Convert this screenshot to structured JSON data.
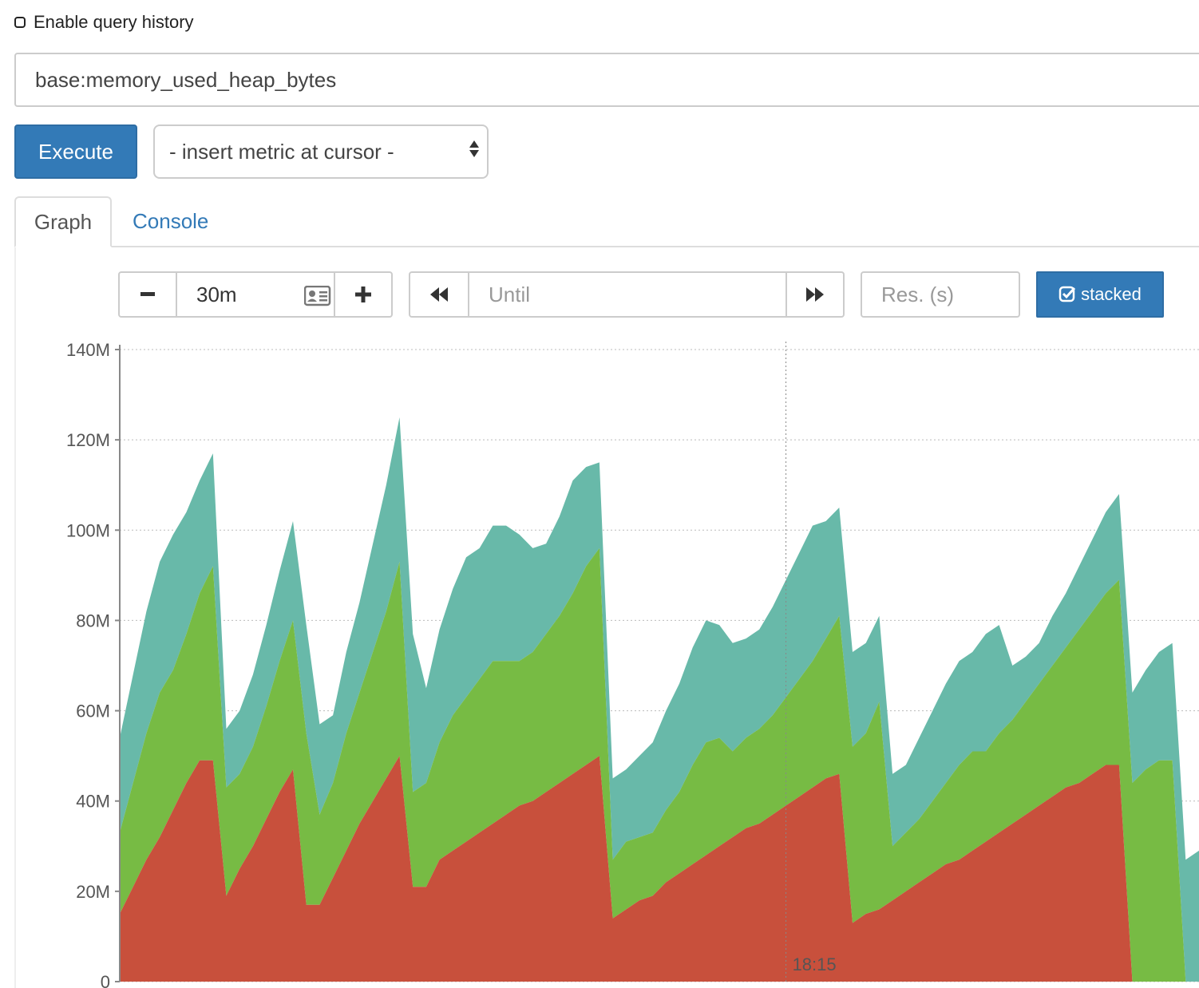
{
  "history": {
    "label": "Enable query history"
  },
  "expression": {
    "value": "base:memory_used_heap_bytes"
  },
  "execute": {
    "label": "Execute"
  },
  "metric_select": {
    "selected": "- insert metric at cursor -"
  },
  "tabs": [
    {
      "label": "Graph"
    },
    {
      "label": "Console"
    }
  ],
  "controls": {
    "minus": "−",
    "range": "30m",
    "plus": "+",
    "until_placeholder": "Until",
    "res_placeholder": "Res. (s)",
    "stacked_label": "stacked"
  },
  "colors": {
    "accent": "#337ab7",
    "series_bottom": "#c8503c",
    "series_middle": "#77bb44",
    "series_top": "#68b9a9"
  },
  "chart_data": {
    "type": "area",
    "stacked": true,
    "ylim": [
      0,
      140000000
    ],
    "y_ticks": [
      {
        "value": 0,
        "label": "0"
      },
      {
        "value": 20000000,
        "label": "20M"
      },
      {
        "value": 40000000,
        "label": "40M"
      },
      {
        "value": 60000000,
        "label": "60M"
      },
      {
        "value": 80000000,
        "label": "80M"
      },
      {
        "value": 100000000,
        "label": "100M"
      },
      {
        "value": 120000000,
        "label": "120M"
      },
      {
        "value": 140000000,
        "label": "140M"
      }
    ],
    "x_ticks": [
      {
        "index": 50,
        "label": "18:15"
      }
    ],
    "grid": true,
    "x": [
      0,
      1,
      2,
      3,
      4,
      5,
      6,
      7,
      8,
      9,
      10,
      11,
      12,
      13,
      14,
      15,
      16,
      17,
      18,
      19,
      20,
      21,
      22,
      23,
      24,
      25,
      26,
      27,
      28,
      29,
      30,
      31,
      32,
      33,
      34,
      35,
      36,
      37,
      38,
      39,
      40,
      41,
      42,
      43,
      44,
      45,
      46,
      47,
      48,
      49,
      50,
      51,
      52,
      53,
      54,
      55,
      56,
      57,
      58,
      59,
      60,
      61,
      62
    ],
    "series": [
      {
        "color": "#c8503c",
        "values": [
          15,
          21,
          27,
          32,
          38,
          44,
          49,
          49,
          19,
          25,
          30,
          36,
          42,
          47,
          17,
          17,
          23,
          29,
          35,
          40,
          45,
          50,
          21,
          21,
          27,
          29,
          31,
          33,
          35,
          37,
          39,
          40,
          42,
          44,
          46,
          48,
          50,
          14,
          16,
          18,
          19,
          22,
          24,
          26,
          28,
          30,
          32,
          34,
          35,
          37,
          39,
          41,
          43,
          45,
          46,
          13,
          15,
          16,
          18,
          20,
          22,
          24,
          26,
          27,
          29,
          31,
          33,
          35,
          37,
          39,
          41,
          43,
          44,
          46,
          48,
          48
        ]
      },
      {
        "color": "#77bb44",
        "values": [
          18,
          23,
          28,
          32,
          31,
          33,
          37,
          43,
          24,
          21,
          22,
          25,
          29,
          33,
          38,
          20,
          21,
          26,
          29,
          33,
          37,
          43,
          21,
          23,
          26,
          30,
          32,
          34,
          36,
          34,
          32,
          33,
          35,
          37,
          40,
          44,
          46,
          13,
          15,
          14,
          14,
          16,
          18,
          22,
          25,
          24,
          19,
          20,
          21,
          22,
          24,
          26,
          28,
          31,
          35,
          39,
          40,
          46,
          12,
          13,
          14,
          16,
          18,
          21,
          22,
          20,
          22,
          23,
          25,
          27,
          29,
          31,
          34,
          36,
          38,
          41,
          44,
          47,
          49,
          49
        ]
      },
      {
        "color": "#68b9a9",
        "values": [
          21,
          24,
          27,
          29,
          30,
          27,
          25,
          25,
          13,
          14,
          16,
          18,
          20,
          22,
          24,
          20,
          15,
          18,
          20,
          24,
          28,
          32,
          35,
          21,
          25,
          28,
          31,
          29,
          30,
          30,
          28,
          23,
          20,
          22,
          25,
          22,
          19,
          18,
          16,
          18,
          20,
          22,
          24,
          26,
          27,
          25,
          24,
          22,
          22,
          24,
          26,
          28,
          30,
          26,
          24,
          21,
          20,
          19,
          16,
          15,
          18,
          20,
          22,
          23,
          22,
          26,
          24,
          12,
          10,
          9,
          11,
          12,
          14,
          16,
          18,
          19,
          20,
          22,
          24,
          26,
          27,
          29
        ]
      }
    ]
  }
}
